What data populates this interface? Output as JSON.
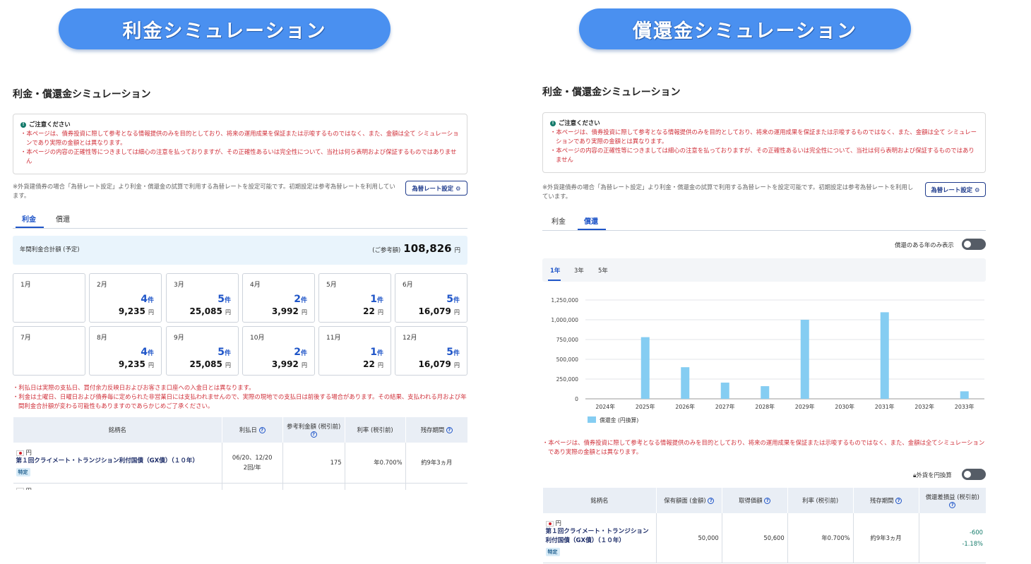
{
  "banners": {
    "left": "利金シミュレーション",
    "right": "償還金シミュレーション"
  },
  "page_title": "利金・償還金シミュレーション",
  "notice": {
    "heading": "ご注意ください",
    "items": [
      "・本ページは、債券投資に際して参考となる情報提供のみを目的としており、将来の運用成果を保証または示唆するものではなく、また、金額は全て シミュレーションであり実際の金額とは異なります。",
      "・本ページの内容の正確性等につきましては細心の注意を払っておりますが、その正確性あるいは完全性について、当社は何ら表明および保証するものではありません"
    ]
  },
  "fx_note": "※外貨建債券の場合「為替レート設定」より利金・償還金の試算で利用する為替レートを設定可能です。初期設定は参考為替レートを利用しています。",
  "fx_button": "為替レート設定",
  "tabs": {
    "interest": "利金",
    "redemption": "償還"
  },
  "interest": {
    "summary_label": "年間利金合計額 (予定)",
    "ref_label": "(ご参考額)",
    "total": "108,826",
    "yen": "円",
    "count_unit": "件",
    "months": [
      {
        "m": "1月",
        "count": "",
        "amount": ""
      },
      {
        "m": "2月",
        "count": "4",
        "amount": "9,235"
      },
      {
        "m": "3月",
        "count": "5",
        "amount": "25,085"
      },
      {
        "m": "4月",
        "count": "2",
        "amount": "3,992"
      },
      {
        "m": "5月",
        "count": "1",
        "amount": "22"
      },
      {
        "m": "6月",
        "count": "5",
        "amount": "16,079"
      },
      {
        "m": "7月",
        "count": "",
        "amount": ""
      },
      {
        "m": "8月",
        "count": "4",
        "amount": "9,235"
      },
      {
        "m": "9月",
        "count": "5",
        "amount": "25,085"
      },
      {
        "m": "10月",
        "count": "2",
        "amount": "3,992"
      },
      {
        "m": "11月",
        "count": "1",
        "amount": "22"
      },
      {
        "m": "12月",
        "count": "5",
        "amount": "16,079"
      }
    ],
    "notes": [
      "・利払日は実際の支払日、買付余力反映日およびお客さま口座への入金日とは異なります。",
      "・利金は土曜日、日曜日および債券毎に定められた非営業日には支払われませんので、実際の現地での支払日は前後する場合があります。その結果、支払われる月および年間利金合計額が変わる可能性もありますのであらかじめご了承ください。"
    ],
    "table": {
      "headers": [
        "銘柄名",
        "利払日",
        "参考利金額 (税引前)",
        "利率 (税引前)",
        "残存期間"
      ],
      "row": {
        "currency": "円",
        "name": "第１回クライメート・トランジション利付国債（GX債）（１０年）",
        "badge": "特定",
        "pay_dates": "06/20、12/20",
        "freq": "2回/年",
        "amount": "175",
        "rate": "年0.700%",
        "remaining": "約9年3ヵ月"
      },
      "next_currency": "円"
    }
  },
  "redemption": {
    "only_years_label": "償還のある年のみ表示",
    "year_tabs": [
      "1年",
      "3年",
      "5年"
    ],
    "legend": "償還金 (円換算)",
    "note": "・本ページは、債券投資に際して参考となる情報提供のみを目的としており、将来の運用成果を保証または示唆するものではなく、また、金額は全てシミュレーションであり実際の金額とは異なります。",
    "fx_toggle_label": "外貨を円換算",
    "table": {
      "headers": [
        "銘柄名",
        "保有額面 (金額)",
        "取得価額",
        "利率 (税引前)",
        "残存期間",
        "償還差損益 (税引前)"
      ],
      "row": {
        "currency": "円",
        "name": "第１回クライメート・トランジション利付国債（GX債）（１０年）",
        "badge": "特定",
        "face": "50,000",
        "cost": "50,600",
        "rate": "年0.700%",
        "remaining": "約9年3ヵ月",
        "pl": "-600",
        "pl_pct": "-1.18%"
      }
    }
  },
  "chart_data": {
    "type": "bar",
    "categories": [
      "2024年",
      "2025年",
      "2026年",
      "2027年",
      "2028年",
      "2029年",
      "2030年",
      "2031年",
      "2032年",
      "2033年"
    ],
    "series": [
      {
        "name": "償還金 (円換算)",
        "values": [
          0,
          780000,
          400000,
          205000,
          160000,
          1000000,
          0,
          1095000,
          0,
          95000
        ]
      }
    ],
    "yticks": [
      "0",
      "250,000",
      "500,000",
      "750,000",
      "1,000,000",
      "1,250,000"
    ],
    "ylim": [
      0,
      1250000
    ],
    "bar_color": "#85cdf2",
    "grid": true,
    "legend": "bottom-left"
  }
}
